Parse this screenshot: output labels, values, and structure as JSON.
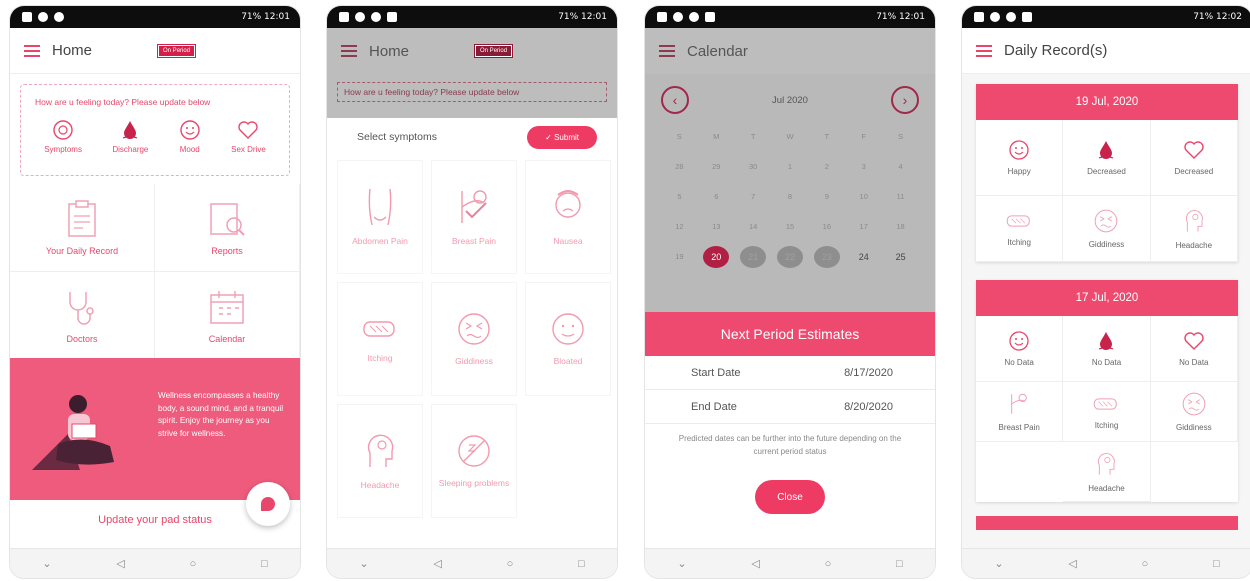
{
  "status_bar": {
    "phones": [
      "71% 12:01",
      "71% 12:01",
      "71% 12:01",
      "71% 12:02"
    ]
  },
  "home_screen": {
    "title": "Home",
    "badge": "On Period",
    "prompt": "How are u feeling today? Please update below",
    "feelings": [
      {
        "label": "Symptoms",
        "icon": "symptoms-icon"
      },
      {
        "label": "Discharge",
        "icon": "drop-icon"
      },
      {
        "label": "Mood",
        "icon": "smiley-icon"
      },
      {
        "label": "Sex Drive",
        "icon": "heart-icon"
      }
    ],
    "tiles": [
      {
        "label": "Your Daily Record",
        "icon": "clipboard-icon"
      },
      {
        "label": "Reports",
        "icon": "report-icon"
      },
      {
        "label": "Doctors",
        "icon": "stethoscope-icon"
      },
      {
        "label": "Calendar",
        "icon": "calendar-icon"
      }
    ],
    "wellness_text": "Wellness encompasses a healthy body, a sound mind, and a tranquil spirit. Enjoy the journey as you strive for wellness.",
    "pad_status": "Update your pad status"
  },
  "symptoms_screen": {
    "title": "Home",
    "badge": "On Period",
    "prompt": "How are u feeling today? Please update below",
    "heading": "Select symptoms",
    "submit": "Submit",
    "symptoms": [
      {
        "label": "Abdomen Pain",
        "icon": "abdomen-icon"
      },
      {
        "label": "Breast Pain",
        "icon": "breast-icon"
      },
      {
        "label": "Nausea",
        "icon": "nausea-icon"
      },
      {
        "label": "Itching",
        "icon": "itching-icon"
      },
      {
        "label": "Giddiness",
        "icon": "dizzy-face-icon"
      },
      {
        "label": "Bloated",
        "icon": "bloated-face-icon"
      },
      {
        "label": "Headache",
        "icon": "headache-icon"
      },
      {
        "label": "Sleeping problems",
        "icon": "sleep-icon"
      }
    ]
  },
  "calendar_screen": {
    "title": "Calendar",
    "month": "Jul 2020",
    "weekdays": [
      "S",
      "M",
      "T",
      "W",
      "T",
      "F",
      "S"
    ],
    "weeks": [
      [
        "28",
        "29",
        "30",
        "1",
        "2",
        "3",
        "4"
      ],
      [
        "5",
        "6",
        "7",
        "8",
        "9",
        "10",
        "11"
      ],
      [
        "12",
        "13",
        "14",
        "15",
        "16",
        "17",
        "18"
      ],
      [
        "19",
        "20",
        "21",
        "22",
        "23",
        "24",
        "25"
      ]
    ],
    "modal": {
      "title": "Next Period Estimates",
      "rows": [
        {
          "label": "Start Date",
          "value": "8/17/2020"
        },
        {
          "label": "End Date",
          "value": "8/20/2020"
        }
      ],
      "note": "Predicted dates can be further into the future depending on the current period status",
      "close": "Close"
    }
  },
  "records_screen": {
    "title": "Daily Record(s)",
    "cards": [
      {
        "date": "19 Jul, 2020",
        "items": [
          {
            "label": "Happy",
            "icon": "smiley-icon"
          },
          {
            "label": "Decreased",
            "icon": "drop-icon"
          },
          {
            "label": "Decreased",
            "icon": "heart-icon"
          },
          {
            "label": "Itching",
            "icon": "itching-icon"
          },
          {
            "label": "Giddiness",
            "icon": "dizzy-face-icon"
          },
          {
            "label": "Headache",
            "icon": "headache-icon"
          }
        ]
      },
      {
        "date": "17 Jul, 2020",
        "items": [
          {
            "label": "No Data",
            "icon": "smiley-icon"
          },
          {
            "label": "No Data",
            "icon": "drop-icon"
          },
          {
            "label": "No Data",
            "icon": "heart-icon"
          },
          {
            "label": "Breast Pain",
            "icon": "breast-icon"
          },
          {
            "label": "Itching",
            "icon": "itching-icon"
          },
          {
            "label": "Giddiness",
            "icon": "dizzy-face-icon"
          },
          {
            "label": "Headache",
            "icon": "headache-icon"
          }
        ]
      }
    ]
  },
  "nav": {
    "back": "◁",
    "home": "○",
    "recent": "□",
    "down": "⌄"
  },
  "colors": {
    "accent": "#ee4a6f",
    "accent_dark": "#b21f44",
    "overlay": "#bdbdbd"
  }
}
